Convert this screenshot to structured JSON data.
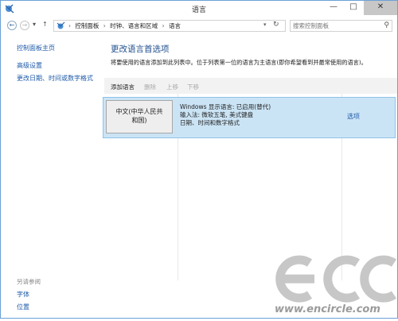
{
  "window": {
    "title": "语言",
    "controls": {
      "minimize": "—",
      "maximize": "□",
      "close": "✕"
    }
  },
  "nav": {
    "back_glyph": "←",
    "forward_glyph": "→",
    "history_caret": "▾",
    "up_glyph": "↑",
    "breadcrumb": [
      "控制面板",
      "时钟、语言和区域",
      "语言"
    ],
    "breadcrumb_sep": "›",
    "caret": "▾",
    "refresh_glyph": "↻",
    "search_placeholder": "搜索控制面板",
    "search_glyph": "⚲"
  },
  "sidebar": {
    "home": "控制面板主页",
    "links": [
      "高级设置",
      "更改日期、时间或数字格式"
    ],
    "see_also_label": "另请参阅",
    "see_also": [
      "字体",
      "位置"
    ]
  },
  "main": {
    "heading": "更改语言首选项",
    "description": "将要使用的语言添加到此列表中。位于列表第一位的语言为主语言(即你希望看到并最常使用的语言)。",
    "toolbar": {
      "add": "添加语言",
      "remove": "删除",
      "up": "上移",
      "down": "下移"
    },
    "languages": [
      {
        "name_line1": "中文(中华人民共",
        "name_line2": "和国)",
        "info": [
          "Windows 显示语言: 已启用(替代)",
          "输入法: 微软五笔, 美式键盘",
          "日期、时间和数字格式"
        ],
        "options": "选项"
      }
    ]
  },
  "watermark": {
    "logo": "ecc",
    "site": "www.encircle.com"
  },
  "colors": {
    "accent_link": "#1e5aa8",
    "heading": "#1e4e8c",
    "selected_row": "#cbe4f5",
    "selected_border": "#8ec2e8"
  }
}
